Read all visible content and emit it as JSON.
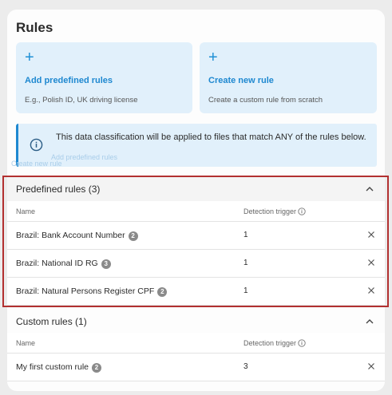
{
  "page": {
    "title": "Rules"
  },
  "cards": [
    {
      "icon": "plus-icon",
      "title": "Add predefined rules",
      "description": "E.g., Polish ID, UK driving license"
    },
    {
      "icon": "plus-icon",
      "title": "Create new rule",
      "description": "Create a custom rule from scratch"
    }
  ],
  "info": {
    "icon": "info-icon",
    "text": "This data classification will be applied to files that match ANY of the rules below."
  },
  "ghost_labels": [
    "Add predefined rules",
    "Create new rule"
  ],
  "predefined": {
    "title": "Predefined rules (3)",
    "columns": {
      "name": "Name",
      "trigger": "Detection trigger"
    },
    "rows": [
      {
        "name": "Brazil: Bank Account Number",
        "badge": "2",
        "trigger": "1"
      },
      {
        "name": "Brazil: National ID RG",
        "badge": "3",
        "trigger": "1"
      },
      {
        "name": "Brazil: Natural Persons Register CPF",
        "badge": "2",
        "trigger": "1"
      }
    ]
  },
  "custom": {
    "title": "Custom rules (1)",
    "columns": {
      "name": "Name",
      "trigger": "Detection trigger"
    },
    "rows": [
      {
        "name": "My first custom rule",
        "badge": "2",
        "trigger": "3"
      }
    ]
  },
  "colors": {
    "accent": "#1e88d0",
    "card_bg": "#e1f0fb",
    "highlight": "#b23030"
  }
}
